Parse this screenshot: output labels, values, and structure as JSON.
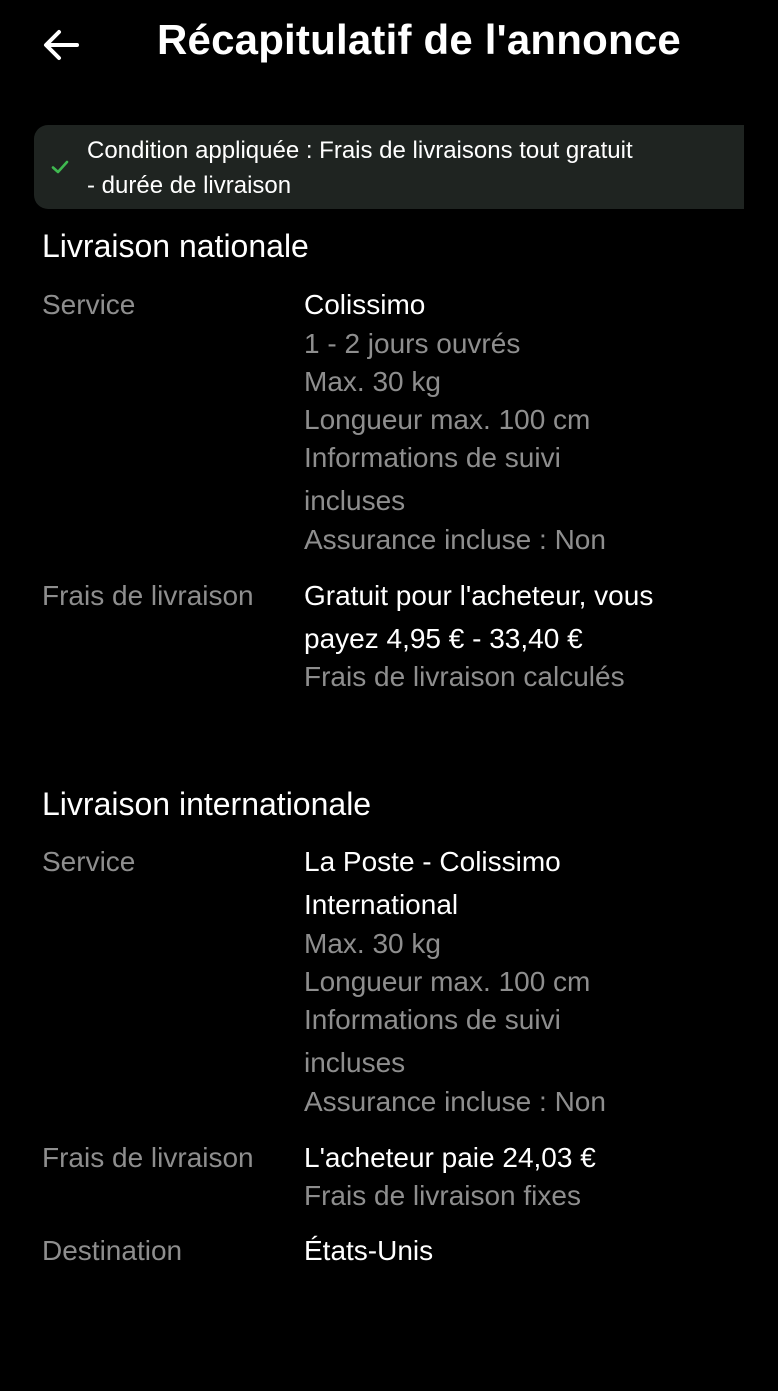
{
  "header": {
    "title": "Récapitulatif de l'annonce",
    "back_icon": "arrow-left-icon"
  },
  "banner": {
    "icon": "check-icon",
    "line1": "Condition appliquée : Frais de livraisons tout gratuit",
    "line2": "- durée de livraison",
    "accent_color": "#3fb950"
  },
  "national": {
    "title": "Livraison nationale",
    "service_label": "Service",
    "service_name": "Colissimo",
    "service_details": [
      "1 - 2 jours ouvrés",
      "Max. 30 kg",
      "Longueur max. 100 cm",
      "Informations de suivi",
      "incluses",
      "Assurance incluse : Non"
    ],
    "fees_label": "Frais de livraison",
    "fees_line1": "Gratuit pour l'acheteur, vous",
    "fees_line2": "payez 4,95 € - 33,40 €",
    "fees_note": "Frais de livraison calculés"
  },
  "international": {
    "title": "Livraison internationale",
    "service_label": "Service",
    "service_name_line1": "La Poste - Colissimo",
    "service_name_line2": "International",
    "service_details": [
      "Max. 30 kg",
      "Longueur max. 100 cm",
      "Informations de suivi",
      "incluses",
      "Assurance incluse : Non"
    ],
    "fees_label": "Frais de livraison",
    "fees_line1": "L'acheteur paie 24,03 €",
    "fees_note": "Frais de livraison fixes",
    "destination_label": "Destination",
    "destination_value": "États-Unis"
  }
}
